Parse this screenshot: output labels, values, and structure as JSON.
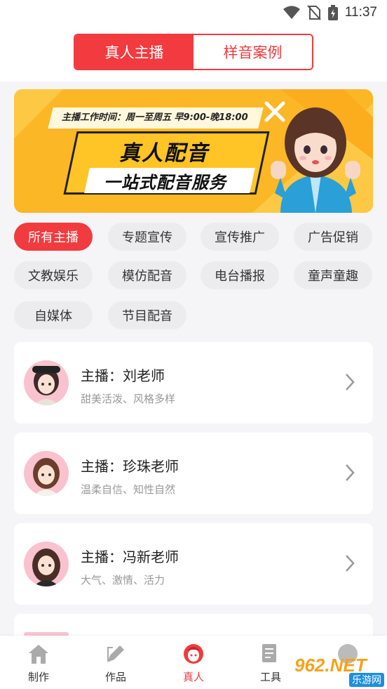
{
  "status_bar": {
    "time": "11:37"
  },
  "header": {
    "tabs": [
      {
        "label": "真人主播",
        "active": true
      },
      {
        "label": "样音案例",
        "active": false
      }
    ]
  },
  "banner": {
    "hours": "主播工作时间：周一至周五  早9:00-晚18:00",
    "title": "真人配音",
    "subtitle": "一站式配音服务"
  },
  "categories": [
    "所有主播",
    "专题宣传",
    "宣传推广",
    "广告促销",
    "文教娱乐",
    "模仿配音",
    "电台播报",
    "童声童趣",
    "自媒体",
    "节目配音"
  ],
  "anchors": [
    {
      "name": "主播：刘老师",
      "desc": "甜美活泼、风格多样"
    },
    {
      "name": "主播：珍珠老师",
      "desc": "温柔自信、知性自然"
    },
    {
      "name": "主播：冯新老师",
      "desc": "大气、激情、活力"
    }
  ],
  "tabbar": {
    "items": [
      {
        "label": "制作",
        "icon": "home-icon"
      },
      {
        "label": "作品",
        "icon": "pencil-icon"
      },
      {
        "label": "真人",
        "icon": "person-icon",
        "active": true
      },
      {
        "label": "工具",
        "icon": "tool-icon"
      },
      {
        "label": "",
        "icon": "profile-icon"
      }
    ]
  },
  "watermark": {
    "brand": "962.NET",
    "sub": "乐游网"
  },
  "colors": {
    "accent": "#f13b3f",
    "banner": "#fcb726"
  }
}
